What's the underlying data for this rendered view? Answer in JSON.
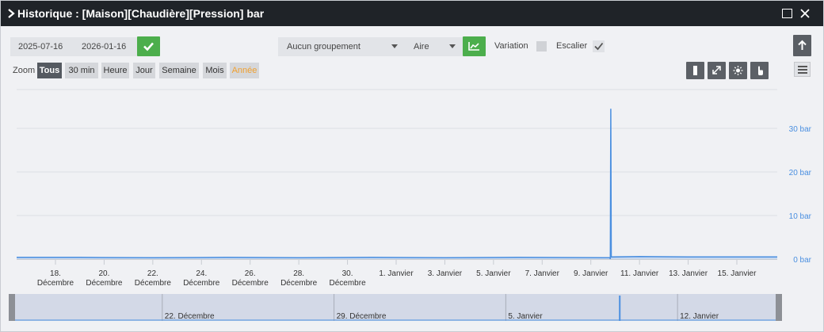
{
  "window": {
    "title": "Historique : [Maison][Chaudière][Pression] bar"
  },
  "toolbar": {
    "start_date": "2025-07-16",
    "end_date": "2026-01-16",
    "grouping": "Aucun groupement",
    "chart_type": "Aire",
    "variation_label": "Variation",
    "stairs_label": "Escalier",
    "zoom_label": "Zoom",
    "zoom_buttons": [
      "Tous",
      "30 min",
      "Heure",
      "Jour",
      "Semaine",
      "Mois",
      "Année"
    ]
  },
  "colors": {
    "series": "#4a8fe0",
    "axis_labels": "#4a8fe0",
    "confirm": "#4cae4c",
    "zoom_active_year": "#f0a030"
  },
  "icons": [
    "chevron-right-icon",
    "maximize-icon",
    "close-icon",
    "check-icon",
    "area-chart-icon",
    "arrow-up-icon",
    "menu-icon",
    "bar-icon",
    "expand-icon",
    "sun-icon",
    "hand-pointer-icon"
  ],
  "chart_data": {
    "type": "area",
    "title": "",
    "xlabel": "",
    "ylabel": "",
    "ylim": [
      0,
      35
    ],
    "y_ticks": [
      "0 bar",
      "10 bar",
      "20 bar",
      "30 bar"
    ],
    "y_tick_values": [
      0,
      10,
      20,
      30
    ],
    "x_tick_labels": [
      [
        "18.",
        "Décembre"
      ],
      [
        "20.",
        "Décembre"
      ],
      [
        "22.",
        "Décembre"
      ],
      [
        "24.",
        "Décembre"
      ],
      [
        "26.",
        "Décembre"
      ],
      [
        "28.",
        "Décembre"
      ],
      [
        "30.",
        "Décembre"
      ],
      [
        "1. Janvier",
        ""
      ],
      [
        "3. Janvier",
        ""
      ],
      [
        "5. Janvier",
        ""
      ],
      [
        "7. Janvier",
        ""
      ],
      [
        "9. Janvier",
        ""
      ],
      [
        "11. Janvier",
        ""
      ],
      [
        "13. Janvier",
        ""
      ],
      [
        "15. Janvier",
        ""
      ]
    ],
    "x_tick_dates": [
      "2025-12-18",
      "2025-12-20",
      "2025-12-22",
      "2025-12-24",
      "2025-12-26",
      "2025-12-28",
      "2025-12-30",
      "2026-01-01",
      "2026-01-03",
      "2026-01-05",
      "2026-01-07",
      "2026-01-09",
      "2026-01-11",
      "2026-01-13",
      "2026-01-15"
    ],
    "x_range": [
      "2025-12-16",
      "2026-01-16"
    ],
    "series": [
      {
        "points": [
          [
            "2025-12-16",
            0.4
          ],
          [
            "2025-12-19",
            0.4
          ],
          [
            "2025-12-22",
            0.3
          ],
          [
            "2025-12-25",
            0.4
          ],
          [
            "2025-12-28",
            0.3
          ],
          [
            "2025-12-31",
            0.4
          ],
          [
            "2026-01-03",
            0.3
          ],
          [
            "2026-01-06",
            0.4
          ],
          [
            "2026-01-09",
            0.3
          ],
          [
            "2026-01-09",
            0.0
          ],
          [
            "2026-01-09",
            34.5
          ],
          [
            "2026-01-09",
            0.5
          ],
          [
            "2026-01-11",
            0.6
          ],
          [
            "2026-01-13",
            0.5
          ],
          [
            "2026-01-16",
            0.5
          ]
        ]
      }
    ],
    "navigator_labels": [
      "22. Décembre",
      "29. Décembre",
      "5. Janvier",
      "12. Janvier"
    ],
    "navigator_dates": [
      "2025-12-22",
      "2025-12-29",
      "2026-01-05",
      "2026-01-12"
    ]
  }
}
